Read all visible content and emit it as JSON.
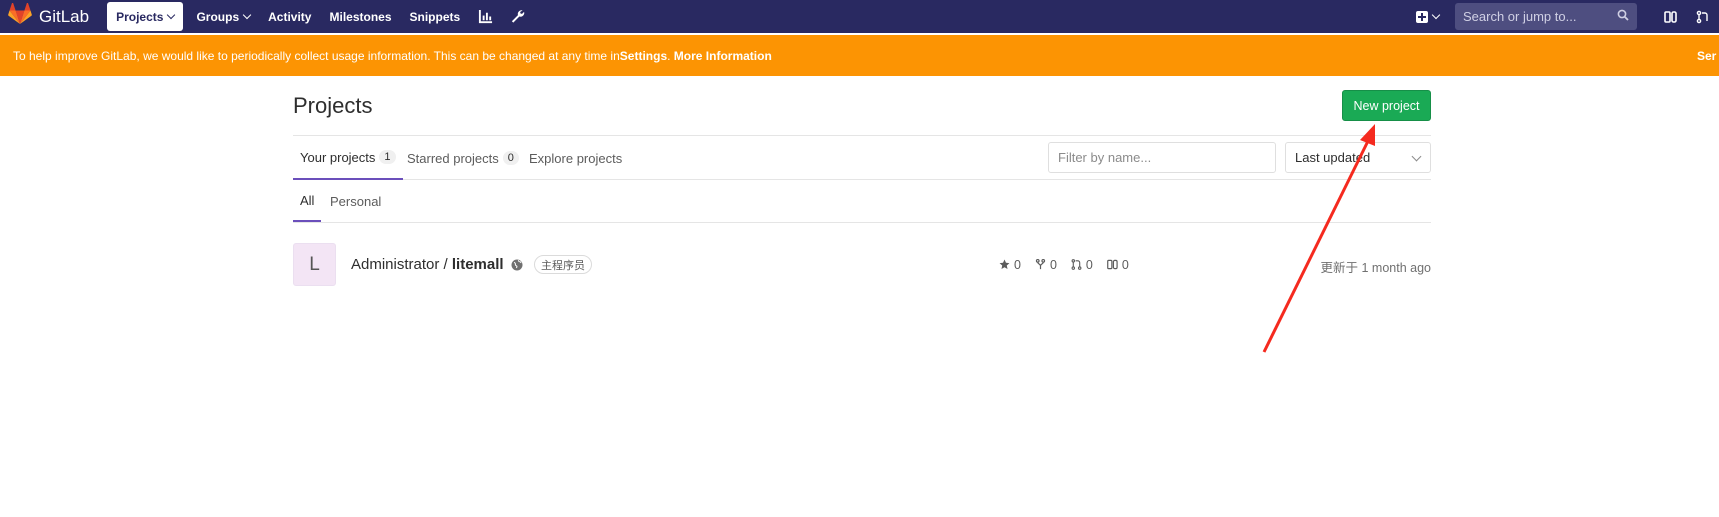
{
  "navbar": {
    "brand": "GitLab",
    "links": [
      {
        "label": "Projects",
        "active": true,
        "dropdown": true
      },
      {
        "label": "Groups",
        "active": false,
        "dropdown": true
      },
      {
        "label": "Activity",
        "active": false,
        "dropdown": false
      },
      {
        "label": "Milestones",
        "active": false,
        "dropdown": false
      },
      {
        "label": "Snippets",
        "active": false,
        "dropdown": false
      }
    ],
    "icons": [
      "chart-icon",
      "wrench-icon"
    ],
    "search_placeholder": "Search or jump to...",
    "right_icons": [
      "issues-icon",
      "merge-request-icon"
    ]
  },
  "banner": {
    "text": "To help improve GitLab, we would like to periodically collect usage information. This can be changed at any time in ",
    "settings_link": "Settings",
    "separator": ". ",
    "more_link": "More Information",
    "right_text": "Ser"
  },
  "page": {
    "title": "Projects",
    "new_project_button": "New project"
  },
  "tabs": [
    {
      "label": "Your projects",
      "count": "1",
      "active": true
    },
    {
      "label": "Starred projects",
      "count": "0",
      "active": false
    },
    {
      "label": "Explore projects",
      "count": null,
      "active": false
    }
  ],
  "filter": {
    "placeholder": "Filter by name...",
    "sort_selected": "Last updated"
  },
  "subtabs": [
    {
      "label": "All",
      "active": true
    },
    {
      "label": "Personal",
      "active": false
    }
  ],
  "projects": [
    {
      "avatar_letter": "L",
      "namespace": "Administrator / ",
      "name": "litemall",
      "visibility_icon": "globe-icon",
      "role": "主程序员",
      "stars": "0",
      "forks": "0",
      "merge_requests": "0",
      "issues": "0",
      "updated": "更新于 1 month ago"
    }
  ],
  "colors": {
    "navbar": "#292961",
    "banner": "#fc9403",
    "primary_button": "#1aaa55",
    "tab_active": "#6b4fbb",
    "annotation_arrow": "#f52a1f"
  }
}
